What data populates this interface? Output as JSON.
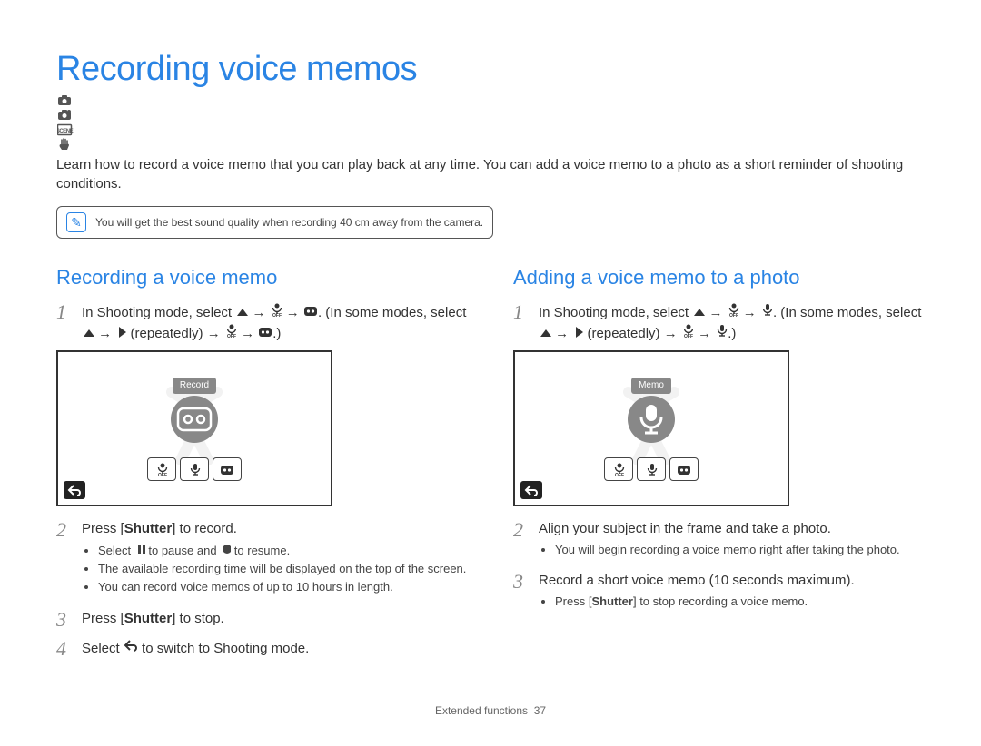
{
  "page": {
    "title": "Recording voice memos",
    "intro": "Learn how to record a voice memo that you can play back at any time. You can add a voice memo to a photo as a short reminder of shooting conditions.",
    "tip": "You will get the best sound quality when recording 40 cm away from the camera.",
    "footer_section": "Extended functions",
    "footer_page": "37"
  },
  "left": {
    "heading": "Recording a voice memo",
    "step1_a": "In Shooting mode, select ",
    "step1_b": ". (In some modes, select ",
    "step1_c": " (repeatedly) ",
    "lcd_label": "Record",
    "step2": "Press [Shutter] to record.",
    "step2_b1a": "Select ",
    "step2_b1b": " to pause and ",
    "step2_b1c": " to resume.",
    "step2_b2": "The available recording time will be displayed on the top of the screen.",
    "step2_b3": "You can record voice memos of up to 10 hours in length.",
    "step3": "Press [Shutter] to stop.",
    "step4a": "Select ",
    "step4b": " to switch to Shooting mode."
  },
  "right": {
    "heading": "Adding a voice memo to a photo",
    "step1_a": "In Shooting mode, select ",
    "step1_b": ". (In some modes, select ",
    "step1_c": " (repeatedly) ",
    "lcd_label": "Memo",
    "step2": "Align your subject in the frame and take a photo.",
    "step2_b1": "You will begin recording a voice memo right after taking the photo.",
    "step3": "Record a short voice memo (10 seconds maximum).",
    "step3_b1": "Press [Shutter] to stop recording a voice memo."
  }
}
